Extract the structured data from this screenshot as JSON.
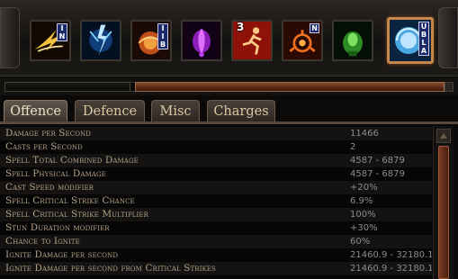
{
  "skill_bar": {
    "slots": [
      {
        "icon": "lightning-arc-icon",
        "badge": "I\nN",
        "badge_style": "vert",
        "selected": false
      },
      {
        "icon": "lightning-burst-icon",
        "badge": "",
        "badge_style": "",
        "selected": false
      },
      {
        "icon": "fire-orb-icon",
        "badge": "I\nI\nB",
        "badge_style": "vert",
        "selected": false
      },
      {
        "icon": "purple-flame-icon",
        "badge": "",
        "badge_style": "",
        "selected": false
      },
      {
        "icon": "sprint-figure-icon",
        "badge": "3",
        "badge_style": "num",
        "selected": false
      },
      {
        "icon": "fire-trap-icon",
        "badge": "N",
        "badge_style": "box",
        "selected": false
      },
      {
        "icon": "green-totem-icon",
        "badge": "",
        "badge_style": "",
        "selected": false
      },
      {
        "icon": "blue-aura-icon",
        "badge": "U\nB\nL\nA",
        "badge_style": "vert",
        "selected": true
      }
    ]
  },
  "tabs": [
    {
      "label": "Offence",
      "active": true
    },
    {
      "label": "Defence",
      "active": false
    },
    {
      "label": "Misc",
      "active": false
    },
    {
      "label": "Charges",
      "active": false
    }
  ],
  "stats": [
    {
      "name": "Damage per Second",
      "value": "11466"
    },
    {
      "name": "Casts per Second",
      "value": "2"
    },
    {
      "name": "Spell Total Combined Damage",
      "value": "4587 - 6879"
    },
    {
      "name": "Spell Physical Damage",
      "value": "4587 - 6879"
    },
    {
      "name": "Cast Speed modifier",
      "value": "+20%"
    },
    {
      "name": "Spell Critical Strike Chance",
      "value": "6.9%"
    },
    {
      "name": "Spell Critical Strike Multiplier",
      "value": "100%"
    },
    {
      "name": "Stun Duration modifier",
      "value": "+30%"
    },
    {
      "name": "Chance to Ignite",
      "value": "60%"
    },
    {
      "name": "Ignite Damage per second",
      "value": "21460.9 - 32180.1"
    },
    {
      "name": "Ignite Damage per second from Critical Strikes",
      "value": "21460.9 - 32180.1"
    },
    {
      "name": "",
      "value": ""
    }
  ],
  "colors": {
    "accent": "#c8874a",
    "stat_name": "#b7a389",
    "stat_value": "#8c8c8c",
    "scroll_thumb": "#7a3a22"
  }
}
